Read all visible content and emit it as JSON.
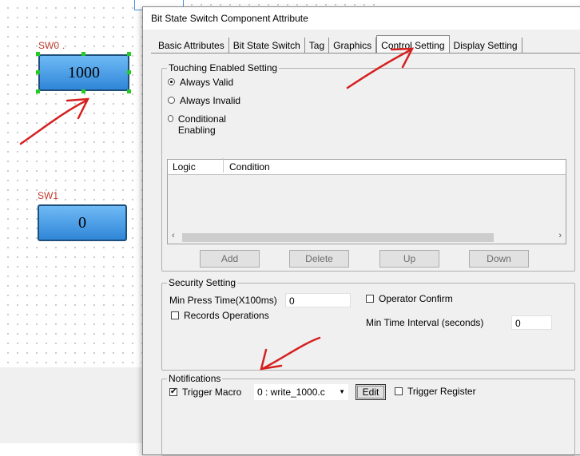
{
  "canvas": {
    "switches": [
      {
        "label": "SW0",
        "value": "1000"
      },
      {
        "label": "SW1",
        "value": "0"
      }
    ]
  },
  "dialog": {
    "title": "Bit State Switch Component Attribute",
    "tabs": [
      {
        "label": "Basic Attributes",
        "active": false
      },
      {
        "label": "Bit State Switch",
        "active": false
      },
      {
        "label": "Tag",
        "active": false
      },
      {
        "label": "Graphics",
        "active": false
      },
      {
        "label": "Control Setting",
        "active": true
      },
      {
        "label": "Display Setting",
        "active": false
      }
    ],
    "touching": {
      "title": "Touching Enabled Setting",
      "options": [
        {
          "label": "Always Valid",
          "selected": true
        },
        {
          "label": "Always Invalid",
          "selected": false
        },
        {
          "label": "Conditional Enabling",
          "selected": false
        }
      ],
      "grid_columns": [
        "Logic",
        "Condition"
      ],
      "buttons": {
        "add": "Add",
        "delete": "Delete",
        "up": "Up",
        "down": "Down"
      }
    },
    "security": {
      "title": "Security Setting",
      "min_press_label": "Min Press Time(X100ms)",
      "min_press_value": "0",
      "records_label": "Records Operations",
      "records_checked": false,
      "operator_confirm_label": "Operator Confirm",
      "operator_confirm_checked": false,
      "min_interval_label": "Min Time Interval (seconds)",
      "min_interval_value": "0"
    },
    "notifications": {
      "title": "Notifications",
      "trigger_macro_label": "Trigger Macro",
      "trigger_macro_checked": true,
      "macro_value": "0 : write_1000.c",
      "edit_label": "Edit",
      "trigger_register_label": "Trigger Register",
      "trigger_register_checked": false
    }
  },
  "colors": {
    "annotation_arrow": "#d62020",
    "switch_fill": "#3f96e4",
    "switch_label": "#c0392b"
  }
}
